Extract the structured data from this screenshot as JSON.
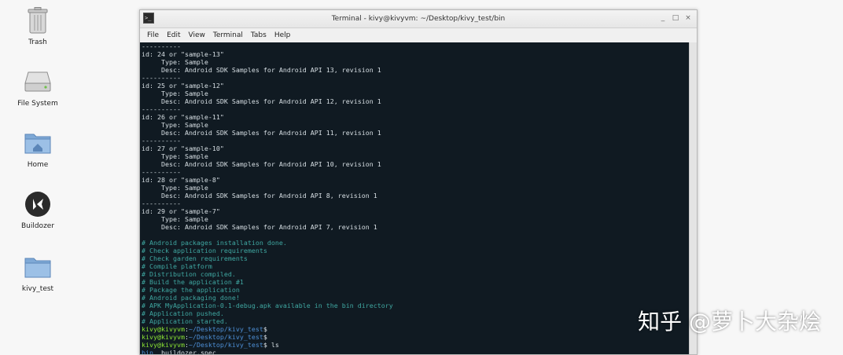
{
  "desktop": {
    "icons": [
      {
        "label": "Trash",
        "icon": "trash-icon"
      },
      {
        "label": "File System",
        "icon": "drive-icon"
      },
      {
        "label": "Home",
        "icon": "folder-icon"
      },
      {
        "label": "Buildozer",
        "icon": "kivy-logo-icon"
      },
      {
        "label": "kivy_test",
        "icon": "folder-icon"
      }
    ]
  },
  "window": {
    "title": "Terminal - kivy@kivyvm: ~/Desktop/kivy_test/bin",
    "controls": [
      "_",
      "□",
      "×"
    ],
    "menu": [
      "File",
      "Edit",
      "View",
      "Terminal",
      "Tabs",
      "Help"
    ]
  },
  "terminal": {
    "lines": [
      {
        "t": "----------",
        "c": "w"
      },
      {
        "t": "id: 24 or \"sample-13\"",
        "c": "w"
      },
      {
        "t": "     Type: Sample",
        "c": "w"
      },
      {
        "t": "     Desc: Android SDK Samples for Android API 13, revision 1",
        "c": "w"
      },
      {
        "t": "----------",
        "c": "w"
      },
      {
        "t": "id: 25 or \"sample-12\"",
        "c": "w"
      },
      {
        "t": "     Type: Sample",
        "c": "w"
      },
      {
        "t": "     Desc: Android SDK Samples for Android API 12, revision 1",
        "c": "w"
      },
      {
        "t": "----------",
        "c": "w"
      },
      {
        "t": "id: 26 or \"sample-11\"",
        "c": "w"
      },
      {
        "t": "     Type: Sample",
        "c": "w"
      },
      {
        "t": "     Desc: Android SDK Samples for Android API 11, revision 1",
        "c": "w"
      },
      {
        "t": "----------",
        "c": "w"
      },
      {
        "t": "id: 27 or \"sample-10\"",
        "c": "w"
      },
      {
        "t": "     Type: Sample",
        "c": "w"
      },
      {
        "t": "     Desc: Android SDK Samples for Android API 10, revision 1",
        "c": "w"
      },
      {
        "t": "----------",
        "c": "w"
      },
      {
        "t": "id: 28 or \"sample-8\"",
        "c": "w"
      },
      {
        "t": "     Type: Sample",
        "c": "w"
      },
      {
        "t": "     Desc: Android SDK Samples for Android API 8, revision 1",
        "c": "w"
      },
      {
        "t": "----------",
        "c": "w"
      },
      {
        "t": "id: 29 or \"sample-7\"",
        "c": "w"
      },
      {
        "t": "     Type: Sample",
        "c": "w"
      },
      {
        "t": "     Desc: Android SDK Samples for Android API 7, revision 1",
        "c": "w"
      },
      {
        "t": "",
        "c": "w"
      },
      {
        "t": "# Android packages installation done.",
        "c": "c"
      },
      {
        "t": "# Check application requirements",
        "c": "c"
      },
      {
        "t": "# Check garden requirements",
        "c": "c"
      },
      {
        "t": "# Compile platform",
        "c": "c"
      },
      {
        "t": "# Distribution compiled.",
        "c": "c"
      },
      {
        "t": "# Build the application #1",
        "c": "c"
      },
      {
        "t": "# Package the application",
        "c": "c"
      },
      {
        "t": "# Android packaging done!",
        "c": "c"
      },
      {
        "t": "# APK MyApplication-0.1-debug.apk available in the bin directory",
        "c": "c"
      },
      {
        "t": "# Application pushed.",
        "c": "c"
      },
      {
        "t": "# Application started.",
        "c": "c"
      }
    ],
    "prompt_user": "kivy@kivyvm",
    "prompt_path": "~/Desktop/kivy_test",
    "prompts": [
      {
        "cmd": ""
      },
      {
        "cmd": ""
      },
      {
        "cmd": " ls"
      }
    ],
    "ls_output": {
      "dir": "bin",
      "file": "  buildozer.spec"
    }
  },
  "watermark": "知乎 @萝卜大杂烩"
}
